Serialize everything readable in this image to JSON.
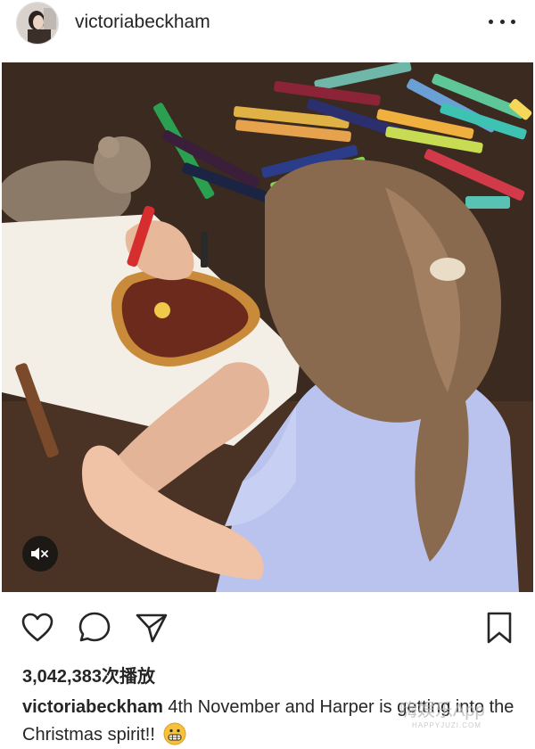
{
  "post": {
    "username": "victoriabeckham",
    "views_text": "3,042,383次播放",
    "caption": {
      "username": "victoriabeckham",
      "text": " 4th November and Harper is getting into the Christmas spirit!!",
      "emoji": "grimacing-face-emoji"
    }
  },
  "icons": {
    "more": "more-options-icon",
    "like": "heart-icon",
    "comment": "comment-icon",
    "share": "share-icon",
    "save": "bookmark-icon",
    "mute": "speaker-muted-icon"
  },
  "watermark": {
    "main": "嗨娱乐App",
    "sub": "HAPPYJUZI.COM"
  },
  "colors": {
    "text": "#262626",
    "background": "#ffffff",
    "table": "#3a2a20",
    "dress": "#b9c3ee",
    "drawing": "#6b2a1c"
  }
}
